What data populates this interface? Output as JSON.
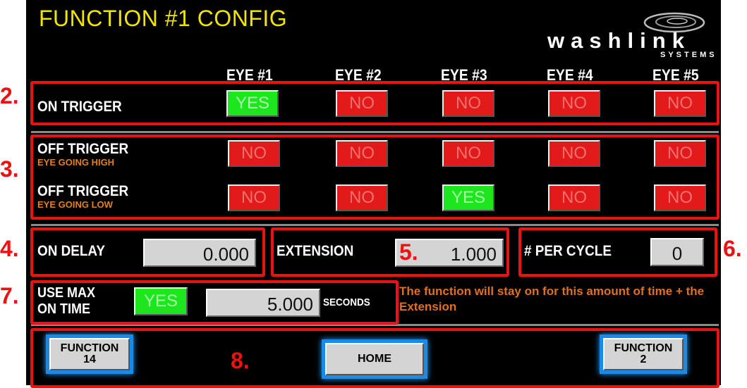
{
  "screen": {
    "title": "FUNCTION #1 CONFIG",
    "logo": {
      "word": "washlink",
      "sub": "SYSTEMS"
    }
  },
  "eyes": [
    "EYE #1",
    "EYE #2",
    "EYE #3",
    "EYE #4",
    "EYE #5"
  ],
  "on_trigger": {
    "label": "ON TRIGGER",
    "values": [
      "YES",
      "NO",
      "NO",
      "NO",
      "NO"
    ]
  },
  "off_trigger_high": {
    "label": "OFF TRIGGER",
    "sub": "EYE GOING HIGH",
    "values": [
      "NO",
      "NO",
      "NO",
      "NO",
      "NO"
    ]
  },
  "off_trigger_low": {
    "label": "OFF TRIGGER",
    "sub": "EYE GOING LOW",
    "values": [
      "NO",
      "NO",
      "YES",
      "NO",
      "NO"
    ]
  },
  "on_delay": {
    "label": "ON DELAY",
    "value": "0.000"
  },
  "extension": {
    "label": "EXTENSION",
    "value": "1.000"
  },
  "per_cycle": {
    "label": "# PER CYCLE",
    "value": "0"
  },
  "max_on_time": {
    "label_line1": "USE MAX",
    "label_line2": "ON TIME",
    "toggle": "YES",
    "value": "5.000",
    "unit": "SECONDS"
  },
  "note": "The function will stay on for this amount of time + the Extension",
  "nav": {
    "prev_line1": "FUNCTION",
    "prev_line2": "14",
    "home": "HOME",
    "next_line1": "FUNCTION",
    "next_line2": "2"
  },
  "annotations": [
    "2.",
    "3.",
    "4.",
    "5.",
    "6.",
    "7.",
    "8."
  ],
  "colors": {
    "title": "#f0e400",
    "yes": "#1ee61e",
    "no": "#e21a1a",
    "annotation": "#ee1111",
    "note": "#e07020"
  }
}
